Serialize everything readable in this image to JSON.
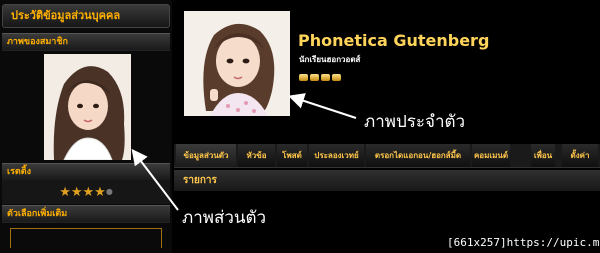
{
  "sidebar": {
    "header": "ประวัติข้อมูลส่วนบุคคล",
    "photo_section": "ภาพของสมาชิก",
    "rating_section": "เรตติ้ง",
    "rating": {
      "filled": 4,
      "total": 5
    },
    "options_section": "ตัวเลือกเพิ่มเติม"
  },
  "profile": {
    "name": "Phonetica Gutenberg",
    "role": "นักเรียนฮอกวอตส์",
    "rank_pips": 4
  },
  "tabs": [
    {
      "label": "ข้อมูลส่วนตัว",
      "active": true
    },
    {
      "label": "หัวข้อ",
      "active": false
    },
    {
      "label": "โพสต์",
      "active": false
    },
    {
      "label": "ประลองเวทย์",
      "active": false
    },
    {
      "label": "ตรอกไดแอกอน/ฮอกส์มี้ด",
      "active": false
    },
    {
      "label": "คอมเมนต์",
      "active": false
    },
    {
      "label": "เพื่อน",
      "active": false
    },
    {
      "label": "ตั้งค่า",
      "active": false
    }
  ],
  "section": {
    "title": "รายการ"
  },
  "annotations": {
    "profile_photo": "ภาพประจำตัว",
    "personal_photo": "ภาพส่วนตัว"
  },
  "credit": "[661x257]https://upic.me/",
  "colors": {
    "accent": "#ffc64a",
    "name": "#ffd45a",
    "background": "#000000"
  }
}
